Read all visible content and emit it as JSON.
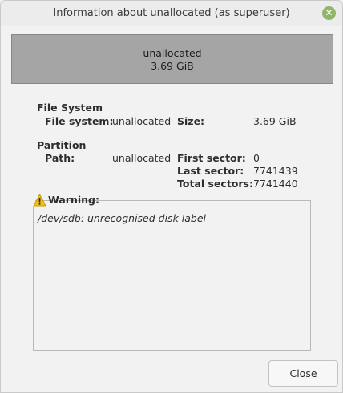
{
  "window": {
    "title": "Information about unallocated (as superuser)"
  },
  "graphic": {
    "name": "unallocated",
    "size": "3.69 GiB",
    "color": "#a5a5a5"
  },
  "filesystem": {
    "heading": "File System",
    "fs_label": "File system:",
    "fs_value": "unallocated",
    "size_label": "Size:",
    "size_value": "3.69 GiB"
  },
  "partition": {
    "heading": "Partition",
    "path_label": "Path:",
    "path_value": "unallocated",
    "first_label": "First sector:",
    "first_value": "0",
    "last_label": "Last sector:",
    "last_value": "7741439",
    "total_label": "Total sectors:",
    "total_value": "7741440"
  },
  "warning": {
    "label": "Warning:",
    "message": "/dev/sdb: unrecognised disk label"
  },
  "buttons": {
    "close": "Close"
  },
  "icons": {
    "window_close": "close-icon",
    "warning": "warning-icon"
  }
}
